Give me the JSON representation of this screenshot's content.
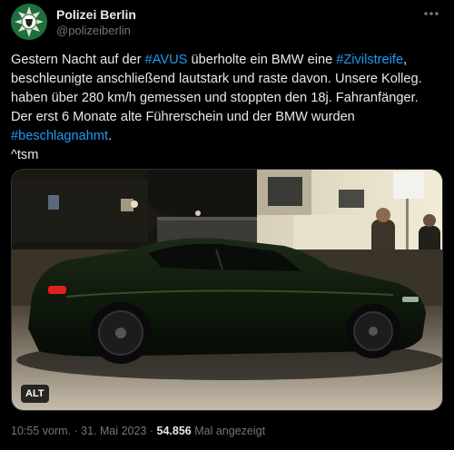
{
  "header": {
    "account_name": "Polizei Berlin",
    "account_handle": "@polizeiberlin",
    "more_icon": "more-horizontal-icon"
  },
  "tweet": {
    "segments": [
      [
        {
          "text": "Gestern Nacht auf der ",
          "type": "text"
        },
        {
          "text": "#AVUS",
          "type": "hashtag"
        },
        {
          "text": " überholte ein BMW eine ",
          "type": "text"
        },
        {
          "text": "#Zivilstreife",
          "type": "hashtag"
        },
        {
          "text": ",",
          "type": "text"
        }
      ],
      [
        {
          "text": "beschleunigte anschließend lautstark und raste davon. Unsere Kolleg.",
          "type": "text"
        }
      ],
      [
        {
          "text": "haben über 280 km/h gemessen und stoppten den 18j. Fahranfänger.",
          "type": "text"
        }
      ],
      [
        {
          "text": "Der erst 6 Monate alte Führerschein und der BMW wurden",
          "type": "text"
        }
      ],
      [
        {
          "text": "#beschlagnahmt",
          "type": "hashtag"
        },
        {
          "text": ".",
          "type": "text"
        }
      ],
      [
        {
          "text": "^tsm",
          "type": "text"
        }
      ]
    ]
  },
  "media": {
    "alt_label": "ALT"
  },
  "meta": {
    "time": "10:55 vorm.",
    "separator": " · ",
    "date": "31. Mai 2023",
    "separator2": " · ",
    "views": "54.856",
    "views_label": " Mal angezeigt"
  },
  "colors": {
    "hashtag": "#1d9bf0",
    "background": "#000000",
    "text": "#e7e9ea",
    "muted": "#71767b"
  }
}
